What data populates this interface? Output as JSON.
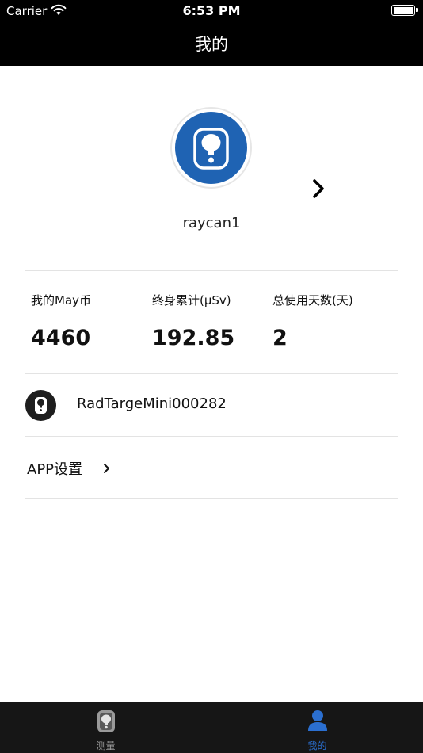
{
  "status_bar": {
    "carrier": "Carrier",
    "time": "6:53 PM"
  },
  "nav": {
    "title": "我的"
  },
  "profile": {
    "username": "raycan1",
    "avatar_icon": "device-icon"
  },
  "stats": [
    {
      "label": "我的May币",
      "value": "4460"
    },
    {
      "label": "终身累计(μSv)",
      "value": "192.85"
    },
    {
      "label": "总使用天数(天)",
      "value": "2"
    }
  ],
  "device": {
    "name": "RadTargeMini000282"
  },
  "settings": {
    "label": "APP设置"
  },
  "tabs": [
    {
      "label": "测量",
      "icon": "measure-device-icon",
      "active": false
    },
    {
      "label": "我的",
      "icon": "person-icon",
      "active": true
    }
  ],
  "colors": {
    "accent": "#1f63b3",
    "tab_active": "#2b6fd0",
    "bar": "#000000"
  }
}
